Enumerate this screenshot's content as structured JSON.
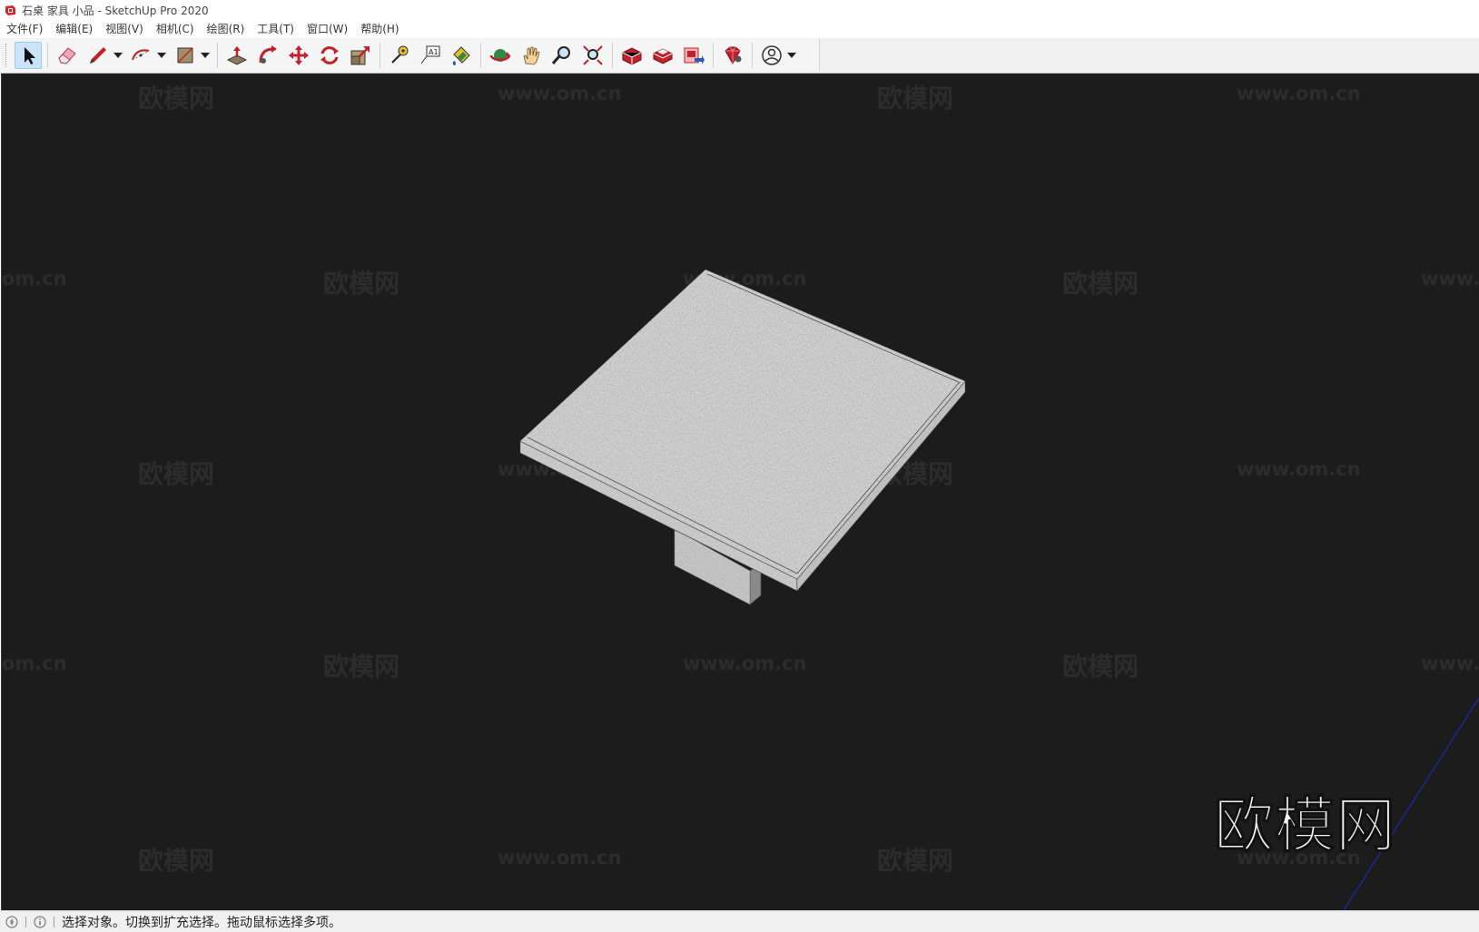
{
  "window": {
    "title": "石桌 家具 小品 - SketchUp Pro 2020",
    "app_icon": "sketchup-logo-icon"
  },
  "menu": {
    "items": [
      {
        "label": "文件(F)"
      },
      {
        "label": "编辑(E)"
      },
      {
        "label": "视图(V)"
      },
      {
        "label": "相机(C)"
      },
      {
        "label": "绘图(R)"
      },
      {
        "label": "工具(T)"
      },
      {
        "label": "窗口(W)"
      },
      {
        "label": "帮助(H)"
      }
    ]
  },
  "toolbar": {
    "tools": [
      "select-arrow-icon",
      "eraser-icon",
      "pencil-line-icon",
      "arc-icon",
      "shape-rectangle-icon",
      "push-pull-icon",
      "follow-me-icon",
      "move-icon",
      "rotate-icon",
      "scale-icon",
      "tape-measure-icon",
      "text-label-icon",
      "paint-bucket-icon",
      "orbit-icon",
      "pan-hand-icon",
      "zoom-icon",
      "zoom-extents-icon",
      "3d-warehouse-icon",
      "extension-warehouse-icon",
      "layout-send-icon",
      "extension-manager-icon",
      "account-icon"
    ],
    "active_tool": "select-arrow-icon"
  },
  "viewport": {
    "background": "#1c1c1c",
    "watermark_cn": "欧模网",
    "watermark_url": "www.om.cn",
    "watermark_url_partial_left": "om.cn",
    "watermark_url_partial_right": "www.",
    "watermark_logo": "欧模网",
    "model": "stone-table"
  },
  "status": {
    "text": "选择对象。切换到扩充选择。拖动鼠标选择多项。",
    "icons": [
      "geo-location-icon",
      "info-icon"
    ]
  }
}
